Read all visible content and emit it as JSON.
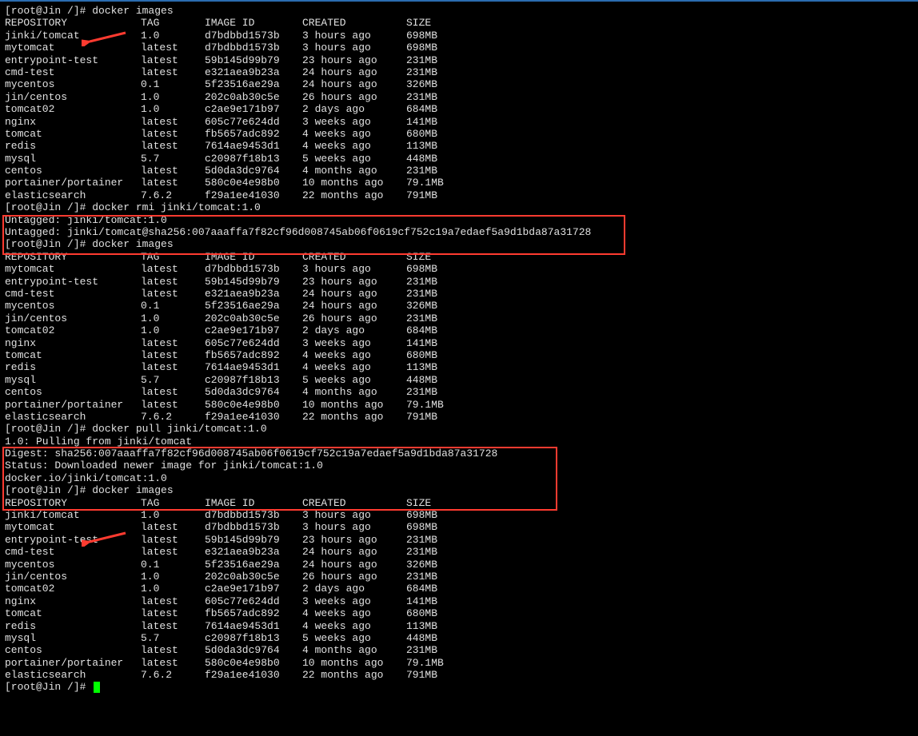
{
  "prompt": "[root@Jin /]# ",
  "cmd_images": "docker images",
  "cmd_rmi": "docker rmi jinki/tomcat:1.0",
  "cmd_pull": "docker pull jinki/tomcat:1.0",
  "cmd_empty": "",
  "headers": {
    "repo": "REPOSITORY",
    "tag": "TAG",
    "id": "IMAGE ID",
    "created": "CREATED",
    "size": "SIZE"
  },
  "list_full": [
    {
      "repo": "jinki/tomcat",
      "tag": "1.0",
      "id": "d7bdbbd1573b",
      "created": "3 hours ago",
      "size": "698MB"
    },
    {
      "repo": "mytomcat",
      "tag": "latest",
      "id": "d7bdbbd1573b",
      "created": "3 hours ago",
      "size": "698MB"
    },
    {
      "repo": "entrypoint-test",
      "tag": "latest",
      "id": "59b145d99b79",
      "created": "23 hours ago",
      "size": "231MB"
    },
    {
      "repo": "cmd-test",
      "tag": "latest",
      "id": "e321aea9b23a",
      "created": "24 hours ago",
      "size": "231MB"
    },
    {
      "repo": "mycentos",
      "tag": "0.1",
      "id": "5f23516ae29a",
      "created": "24 hours ago",
      "size": "326MB"
    },
    {
      "repo": "jin/centos",
      "tag": "1.0",
      "id": "202c0ab30c5e",
      "created": "26 hours ago",
      "size": "231MB"
    },
    {
      "repo": "tomcat02",
      "tag": "1.0",
      "id": "c2ae9e171b97",
      "created": "2 days ago",
      "size": "684MB"
    },
    {
      "repo": "nginx",
      "tag": "latest",
      "id": "605c77e624dd",
      "created": "3 weeks ago",
      "size": "141MB"
    },
    {
      "repo": "tomcat",
      "tag": "latest",
      "id": "fb5657adc892",
      "created": "4 weeks ago",
      "size": "680MB"
    },
    {
      "repo": "redis",
      "tag": "latest",
      "id": "7614ae9453d1",
      "created": "4 weeks ago",
      "size": "113MB"
    },
    {
      "repo": "mysql",
      "tag": "5.7",
      "id": "c20987f18b13",
      "created": "5 weeks ago",
      "size": "448MB"
    },
    {
      "repo": "centos",
      "tag": "latest",
      "id": "5d0da3dc9764",
      "created": "4 months ago",
      "size": "231MB"
    },
    {
      "repo": "portainer/portainer",
      "tag": "latest",
      "id": "580c0e4e98b0",
      "created": "10 months ago",
      "size": "79.1MB"
    },
    {
      "repo": "elasticsearch",
      "tag": "7.6.2",
      "id": "f29a1ee41030",
      "created": "22 months ago",
      "size": "791MB"
    }
  ],
  "list_after_rmi": [
    {
      "repo": "mytomcat",
      "tag": "latest",
      "id": "d7bdbbd1573b",
      "created": "3 hours ago",
      "size": "698MB"
    },
    {
      "repo": "entrypoint-test",
      "tag": "latest",
      "id": "59b145d99b79",
      "created": "23 hours ago",
      "size": "231MB"
    },
    {
      "repo": "cmd-test",
      "tag": "latest",
      "id": "e321aea9b23a",
      "created": "24 hours ago",
      "size": "231MB"
    },
    {
      "repo": "mycentos",
      "tag": "0.1",
      "id": "5f23516ae29a",
      "created": "24 hours ago",
      "size": "326MB"
    },
    {
      "repo": "jin/centos",
      "tag": "1.0",
      "id": "202c0ab30c5e",
      "created": "26 hours ago",
      "size": "231MB"
    },
    {
      "repo": "tomcat02",
      "tag": "1.0",
      "id": "c2ae9e171b97",
      "created": "2 days ago",
      "size": "684MB"
    },
    {
      "repo": "nginx",
      "tag": "latest",
      "id": "605c77e624dd",
      "created": "3 weeks ago",
      "size": "141MB"
    },
    {
      "repo": "tomcat",
      "tag": "latest",
      "id": "fb5657adc892",
      "created": "4 weeks ago",
      "size": "680MB"
    },
    {
      "repo": "redis",
      "tag": "latest",
      "id": "7614ae9453d1",
      "created": "4 weeks ago",
      "size": "113MB"
    },
    {
      "repo": "mysql",
      "tag": "5.7",
      "id": "c20987f18b13",
      "created": "5 weeks ago",
      "size": "448MB"
    },
    {
      "repo": "centos",
      "tag": "latest",
      "id": "5d0da3dc9764",
      "created": "4 months ago",
      "size": "231MB"
    },
    {
      "repo": "portainer/portainer",
      "tag": "latest",
      "id": "580c0e4e98b0",
      "created": "10 months ago",
      "size": "79.1MB"
    },
    {
      "repo": "elasticsearch",
      "tag": "7.6.2",
      "id": "f29a1ee41030",
      "created": "22 months ago",
      "size": "791MB"
    }
  ],
  "rmi_out": {
    "l1": "Untagged: jinki/tomcat:1.0",
    "l2": "Untagged: jinki/tomcat@sha256:007aaaffa7f82cf96d008745ab06f0619cf752c19a7edaef5a9d1bda87a31728"
  },
  "pull_out": {
    "l1": "1.0: Pulling from jinki/tomcat",
    "l2": "Digest: sha256:007aaaffa7f82cf96d008745ab06f0619cf752c19a7edaef5a9d1bda87a31728",
    "l3": "Status: Downloaded newer image for jinki/tomcat:1.0",
    "l4": "docker.io/jinki/tomcat:1.0"
  },
  "annotations": {
    "arrow_color": "#ff3b30",
    "box_color": "#ff3b30"
  }
}
